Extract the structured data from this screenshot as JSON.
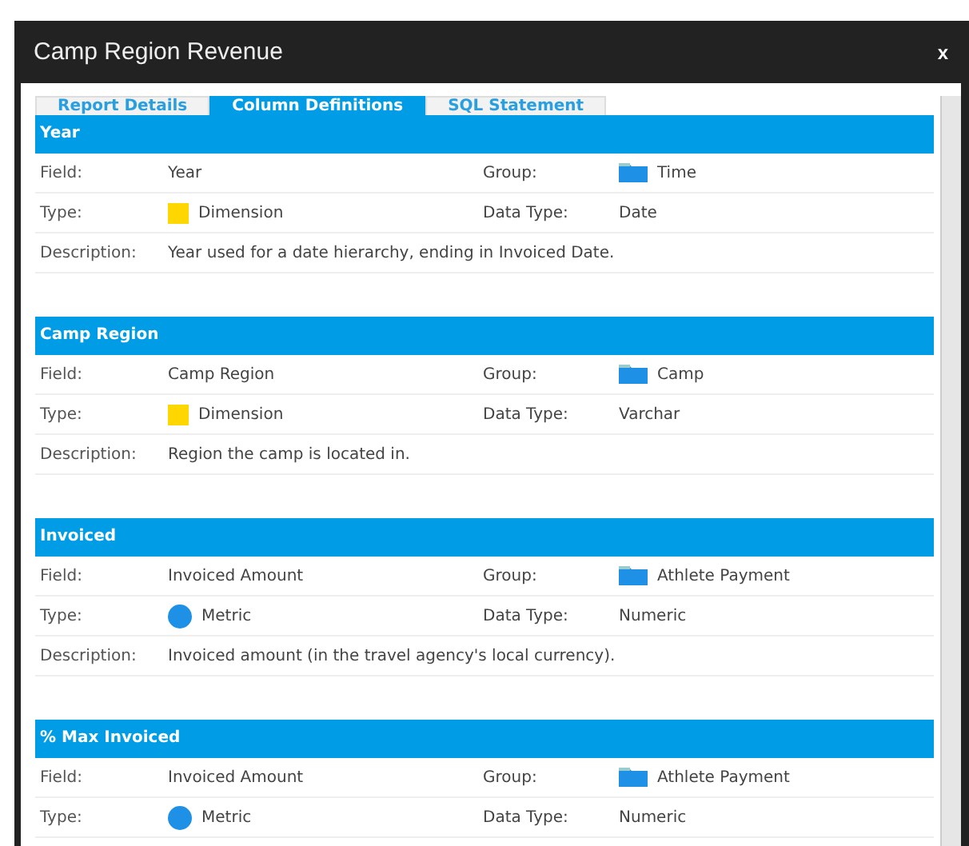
{
  "window": {
    "title": "Camp Region Revenue",
    "close": "x"
  },
  "tabs": [
    {
      "label": "Report Details",
      "selected": false
    },
    {
      "label": "Column Definitions",
      "selected": true
    },
    {
      "label": "SQL Statement",
      "selected": false
    }
  ],
  "sections": [
    {
      "title": "Year",
      "field_label": "Field:",
      "field": "Year",
      "group_label": "Group:",
      "group": "Time",
      "type_label": "Type:",
      "kind": "dimension",
      "type": "Dimension",
      "data_type_label": "Data Type:",
      "data_type": "Date",
      "description_label": "Description:",
      "description": "Year used for a date hierarchy, ending in Invoiced Date."
    },
    {
      "title": "Camp Region",
      "field_label": "Field:",
      "field": "Camp Region",
      "group_label": "Group:",
      "group": "Camp",
      "type_label": "Type:",
      "kind": "dimension",
      "type": "Dimension",
      "data_type_label": "Data Type:",
      "data_type": "Varchar",
      "description_label": "Description:",
      "description": "Region the camp is located in."
    },
    {
      "title": "Invoiced",
      "field_label": "Field:",
      "field": "Invoiced Amount",
      "group_label": "Group:",
      "group": "Athlete Payment",
      "type_label": "Type:",
      "kind": "metric",
      "type": "Metric",
      "data_type_label": "Data Type:",
      "data_type": "Numeric",
      "description_label": "Description:",
      "description": "Invoiced amount (in the travel agency's local currency)."
    },
    {
      "title": "% Max Invoiced",
      "field_label": "Field:",
      "field": "Invoiced Amount",
      "group_label": "Group:",
      "group": "Athlete Payment",
      "type_label": "Type:",
      "kind": "metric",
      "type": "Metric",
      "data_type_label": "Data Type:",
      "data_type": "Numeric"
    }
  ]
}
